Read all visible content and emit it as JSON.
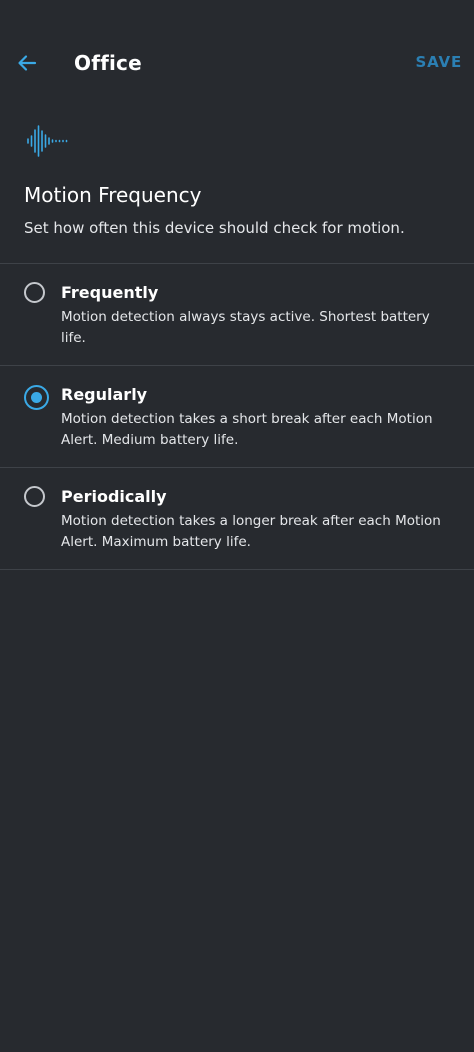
{
  "colors": {
    "background": "#272a2f",
    "accent": "#3aa9e6",
    "save": "#2b7fb3",
    "text": "#ffffff",
    "divider": "#3e4248"
  },
  "header": {
    "back_icon": "arrow-left-icon",
    "title": "Office",
    "save_label": "SAVE"
  },
  "intro": {
    "icon": "motion-waveform-icon",
    "title": "Motion Frequency",
    "description": "Set how often this device should check for motion."
  },
  "options": [
    {
      "label": "Frequently",
      "desc_line1": "Motion detection always stays active. Shortest battery",
      "desc_line2": "life.",
      "selected": false
    },
    {
      "label": "Regularly",
      "desc_line1": "Motion detection takes a short break after each Motion",
      "desc_line2": "Alert. Medium battery life.",
      "selected": true
    },
    {
      "label": "Periodically",
      "desc_line1": "Motion detection takes a longer break after each Motion",
      "desc_line2": "Alert. Maximum battery life.",
      "selected": false
    }
  ]
}
